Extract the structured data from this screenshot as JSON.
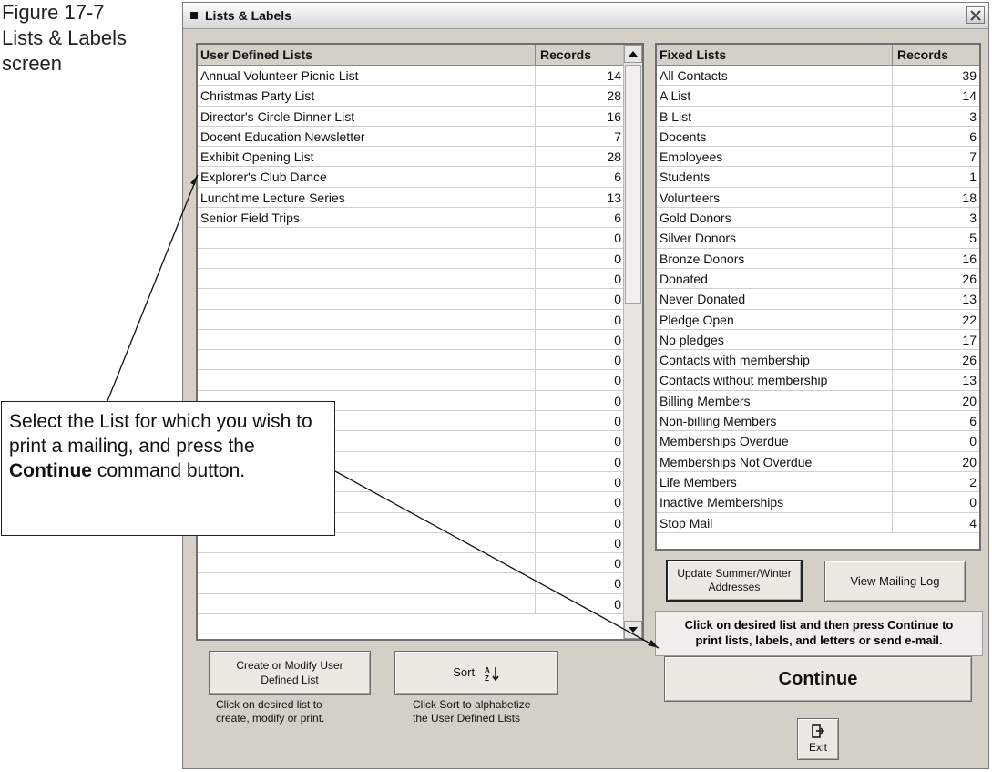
{
  "caption": {
    "line1": "Figure 17-7",
    "line2": "Lists & Labels",
    "line3": "screen"
  },
  "window": {
    "title": "Lists & Labels"
  },
  "user_lists": {
    "header_name": "User Defined Lists",
    "header_records": "Records",
    "rows": [
      {
        "name": "Annual Volunteer Picnic List",
        "records": "14"
      },
      {
        "name": "Christmas Party List",
        "records": "28"
      },
      {
        "name": "Director's Circle Dinner List",
        "records": "16"
      },
      {
        "name": "Docent Education Newsletter",
        "records": "7"
      },
      {
        "name": "Exhibit Opening List",
        "records": "28"
      },
      {
        "name": "Explorer's Club Dance",
        "records": "6"
      },
      {
        "name": "Lunchtime Lecture Series",
        "records": "13"
      },
      {
        "name": "Senior Field Trips",
        "records": "6"
      },
      {
        "name": "",
        "records": "0"
      },
      {
        "name": "",
        "records": "0"
      },
      {
        "name": "",
        "records": "0"
      },
      {
        "name": "",
        "records": "0"
      },
      {
        "name": "",
        "records": "0"
      },
      {
        "name": "",
        "records": "0"
      },
      {
        "name": "",
        "records": "0"
      },
      {
        "name": "",
        "records": "0"
      },
      {
        "name": "",
        "records": "0"
      },
      {
        "name": "",
        "records": "0"
      },
      {
        "name": "",
        "records": "0"
      },
      {
        "name": "",
        "records": "0"
      },
      {
        "name": "",
        "records": "0"
      },
      {
        "name": "",
        "records": "0"
      },
      {
        "name": "",
        "records": "0"
      },
      {
        "name": "",
        "records": "0"
      },
      {
        "name": "",
        "records": "0"
      },
      {
        "name": "",
        "records": "0"
      },
      {
        "name": "",
        "records": "0"
      }
    ]
  },
  "fixed_lists": {
    "header_name": "Fixed Lists",
    "header_records": "Records",
    "rows": [
      {
        "name": "All Contacts",
        "records": "39"
      },
      {
        "name": "A List",
        "records": "14"
      },
      {
        "name": "B List",
        "records": "3"
      },
      {
        "name": "Docents",
        "records": "6"
      },
      {
        "name": "Employees",
        "records": "7"
      },
      {
        "name": "Students",
        "records": "1"
      },
      {
        "name": "Volunteers",
        "records": "18"
      },
      {
        "name": "Gold Donors",
        "records": "3"
      },
      {
        "name": "Silver Donors",
        "records": "5"
      },
      {
        "name": "Bronze Donors",
        "records": "16"
      },
      {
        "name": "Donated",
        "records": "26"
      },
      {
        "name": "Never Donated",
        "records": "13"
      },
      {
        "name": "Pledge Open",
        "records": "22"
      },
      {
        "name": "No pledges",
        "records": "17"
      },
      {
        "name": "Contacts with membership",
        "records": "26"
      },
      {
        "name": "Contacts without membership",
        "records": "13"
      },
      {
        "name": "Billing Members",
        "records": "20"
      },
      {
        "name": "Non-billing Members",
        "records": "6"
      },
      {
        "name": "Memberships Overdue",
        "records": "0"
      },
      {
        "name": "Memberships Not Overdue",
        "records": "20"
      },
      {
        "name": "Life Members",
        "records": "2"
      },
      {
        "name": "Inactive Memberships",
        "records": "0"
      },
      {
        "name": "Stop Mail",
        "records": "4"
      }
    ]
  },
  "buttons": {
    "update_line1": "Update Summer/Winter",
    "update_line2": "Addresses",
    "view_log": "View Mailing Log",
    "create_line1": "Create or Modify User",
    "create_line2": "Defined List",
    "sort": "Sort",
    "continue": "Continue",
    "exit": "Exit"
  },
  "info": {
    "line1": "Click on desired list and then press Continue to",
    "line2": "print lists, labels, and letters or send e-mail."
  },
  "hints": {
    "create_line1": "Click on desired list to",
    "create_line2": "create, modify or print.",
    "sort_line1": "Click Sort to alphabetize",
    "sort_line2": "the User Defined Lists"
  },
  "callout": {
    "text1": "Select the List for which you wish to print a mailing, and press the ",
    "bold": "Continue",
    "text2": " command button."
  },
  "icons": [
    "close-icon",
    "sort-az-icon",
    "exit-door-icon",
    "scroll-up-arrow-icon",
    "scroll-down-arrow-icon"
  ]
}
